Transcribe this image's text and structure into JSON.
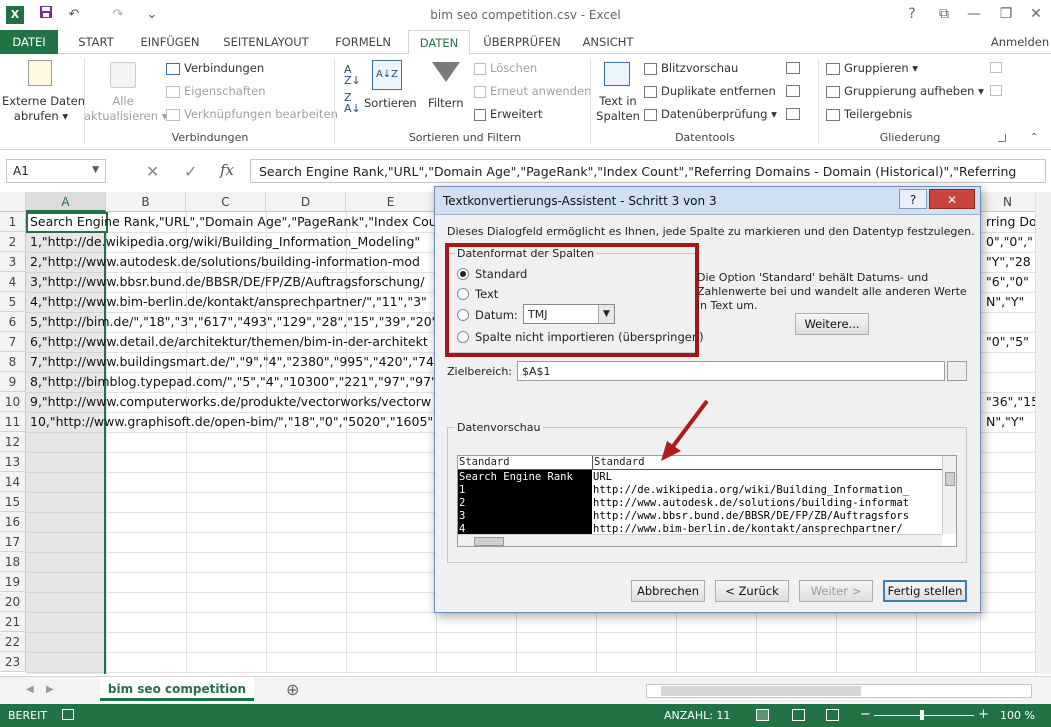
{
  "window": {
    "title": "bim seo competition.csv - Excel",
    "help": "?",
    "ribbon_opts": "⧉",
    "minimize": "—",
    "restore": "❐",
    "close": "✕"
  },
  "qat": {
    "undo": "↶",
    "redo": "↷",
    "more": "⌄"
  },
  "tabs": [
    "DATEI",
    "START",
    "EINFÜGEN",
    "SEITENLAYOUT",
    "FORMELN",
    "DATEN",
    "ÜBERPRÜFEN",
    "ANSICHT"
  ],
  "account": "Anmelden",
  "ribbon": {
    "external_data": [
      "Externe Daten",
      "abrufen ▾"
    ],
    "refresh_all": [
      "Alle",
      "aktualisieren ▾"
    ],
    "connections": "Verbindungen",
    "properties": "Eigenschaften",
    "edit_links": "Verknüpfungen bearbeiten",
    "group_connections": "Verbindungen",
    "sort_az_icon": "A↓Z",
    "sort": "Sortieren",
    "filter": "Filtern",
    "clear": "Löschen",
    "reapply": "Erneut anwenden",
    "advanced": "Erweitert",
    "group_sort": "Sortieren und Filtern",
    "text_to_columns": [
      "Text in",
      "Spalten"
    ],
    "flash_fill": "Blitzvorschau",
    "remove_duplicates": "Duplikate entfernen",
    "data_validation": "Datenüberprüfung ▾",
    "group_tools": "Datentools",
    "group": "Gruppieren ▾",
    "ungroup": "Gruppierung aufheben ▾",
    "subtotal": "Teilergebnis",
    "group_outline": "Gliederung"
  },
  "formula_bar": {
    "name_box": "A1",
    "cancel": "✕",
    "enter": "✓",
    "fx": "fx",
    "content": "Search Engine Rank,\"URL\",\"Domain Age\",\"PageRank\",\"Index Count\",\"Referring Domains - Domain (Historical)\",\"Referring"
  },
  "columns": [
    "A",
    "B",
    "C",
    "D",
    "E",
    "N"
  ],
  "rows": [
    "1",
    "2",
    "3",
    "4",
    "5",
    "6",
    "7",
    "8",
    "9",
    "10",
    "11",
    "12",
    "13",
    "14",
    "15",
    "16",
    "17",
    "18",
    "19",
    "20",
    "21",
    "22",
    "23"
  ],
  "cells": [
    "Search Engine Rank,\"URL\",\"Domain Age\",\"PageRank\",\"Index Coun",
    "1,\"http://de.wikipedia.org/wiki/Building_Information_Modeling\"",
    "2,\"http://www.autodesk.de/solutions/building-information-mod",
    "3,\"http://www.bbsr.bund.de/BBSR/DE/FP/ZB/Auftragsforschung/",
    "4,\"http://www.bim-berlin.de/kontakt/ansprechpartner/\",\"11\",\"3\"",
    "5,\"http://bim.de/\",\"18\",\"3\",\"617\",\"493\",\"129\",\"28\",\"15\",\"39\",\"20\",",
    "6,\"http://www.detail.de/architektur/themen/bim-in-der-architekt",
    "7,\"http://www.buildingsmart.de/\",\"9\",\"4\",\"2380\",\"995\",\"420\",\"740",
    "8,\"http://bimblog.typepad.com/\",\"5\",\"4\",\"10300\",\"221\",\"97\",\"97\",",
    "9,\"http://www.computerworks.de/produkte/vectorworks/vectorw",
    "10,\"http://www.graphisoft.de/open-bim/\",\"18\",\"0\",\"5020\",\"1605\""
  ],
  "right_cells": [
    "rring Do",
    "0\",\"0\",\"",
    "\"Y\",\"28",
    "\"6\",\"0\"",
    "N\",\"Y\"",
    "",
    "\"0\",\"5\"",
    "",
    "",
    "\"36\",\"15",
    "N\",\"Y\""
  ],
  "sheet": {
    "tab": "bim seo competition",
    "add": "⊕"
  },
  "status": {
    "ready": "BEREIT",
    "count": "ANZAHL: 11",
    "zoom": "100 %",
    "minus": "−",
    "plus": "+"
  },
  "dialog": {
    "title": "Textkonvertierungs-Assistent - Schritt 3 von 3",
    "help": "?",
    "close": "✕",
    "intro": "Dieses Dialogfeld ermöglicht es Ihnen, jede Spalte zu markieren und den Datentyp festzulegen.",
    "format_group": "Datenformat der Spalten",
    "opt_standard": "Standard",
    "opt_text": "Text",
    "opt_date": "Datum:",
    "date_value": "TMJ",
    "opt_skip": "Spalte nicht importieren (überspringen)",
    "info": "Die Option 'Standard' behält Datums- und Zahlenwerte bei und wandelt alle anderen Werte in Text um.",
    "more": "Weitere...",
    "target_label": "Zielbereich:",
    "target_value": "$A$1",
    "preview_label": "Datenvorschau",
    "preview_h1": "Standard",
    "preview_h2": "Standard",
    "preview_col1": [
      "Search Engine Rank",
      "1",
      "2",
      "3",
      "4"
    ],
    "preview_col2": [
      "URL",
      "http://de.wikipedia.org/wiki/Building_Information_",
      "http://www.autodesk.de/solutions/building-informat",
      "http://www.bbsr.bund.de/BBSR/DE/FP/ZB/Auftragsfors",
      "http://www.bim-berlin.de/kontakt/ansprechpartner/"
    ],
    "btn_cancel": "Abbrechen",
    "btn_back": "< Zurück",
    "btn_next": "Weiter >",
    "btn_finish": "Fertig stellen"
  },
  "colors": {
    "excel_green": "#217346",
    "highlight_red": "#a4161a",
    "arrow_red": "#b01c1c"
  }
}
